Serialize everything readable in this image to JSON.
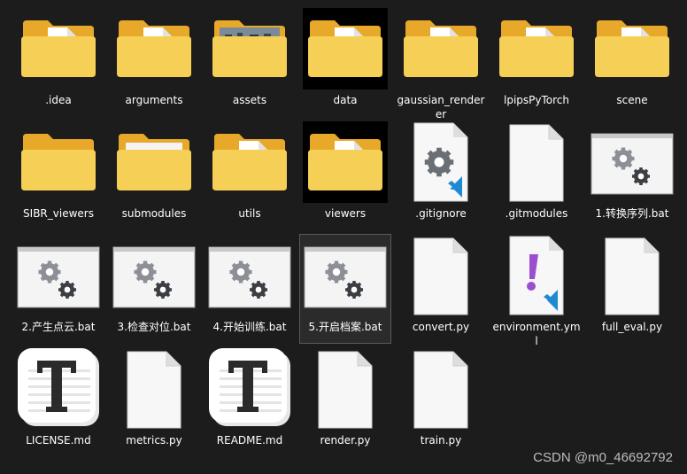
{
  "items": [
    {
      "label": ".idea",
      "type": "folder-doc"
    },
    {
      "label": "arguments",
      "type": "folder-doc"
    },
    {
      "label": "assets",
      "type": "folder-photo"
    },
    {
      "label": "data",
      "type": "folder-doc-dark"
    },
    {
      "label": "gaussian_renderer",
      "type": "folder-doc"
    },
    {
      "label": "lpipsPyTorch",
      "type": "folder-doc"
    },
    {
      "label": "scene",
      "type": "folder-doc"
    },
    {
      "label": "SIBR_viewers",
      "type": "folder"
    },
    {
      "label": "submodules",
      "type": "folder-paper"
    },
    {
      "label": "utils",
      "type": "folder-doc"
    },
    {
      "label": "viewers",
      "type": "folder-doc-dark"
    },
    {
      "label": ".gitignore",
      "type": "vscode-gear"
    },
    {
      "label": ".gitmodules",
      "type": "blank"
    },
    {
      "label": "1.转换序列.bat",
      "type": "bat"
    },
    {
      "label": "2.产生点云.bat",
      "type": "bat"
    },
    {
      "label": "3.检查对位.bat",
      "type": "bat"
    },
    {
      "label": "4.开始训练.bat",
      "type": "bat"
    },
    {
      "label": "5.开启档案.bat",
      "type": "bat",
      "selected": true
    },
    {
      "label": "convert.py",
      "type": "blank"
    },
    {
      "label": "environment.yml",
      "type": "yml"
    },
    {
      "label": "full_eval.py",
      "type": "blank"
    },
    {
      "label": "LICENSE.md",
      "type": "markdown"
    },
    {
      "label": "metrics.py",
      "type": "blank"
    },
    {
      "label": "README.md",
      "type": "markdown"
    },
    {
      "label": "render.py",
      "type": "blank"
    },
    {
      "label": "train.py",
      "type": "blank"
    }
  ],
  "watermark": "CSDN @m0_46692792",
  "colors": {
    "background": "#1c1c1c",
    "folder_back": "#e8a92a",
    "folder_front": "#f6cf56",
    "vscode_blue": "#1f8ad2",
    "yml_purple": "#9b4fd0",
    "gear": "#6a6f76"
  },
  "icons": {
    "folder": "folder-icon",
    "file": "file-icon",
    "bat": "gear-window-icon",
    "markdown": "typora-t-icon",
    "vscode": "vscode-badge-icon"
  }
}
